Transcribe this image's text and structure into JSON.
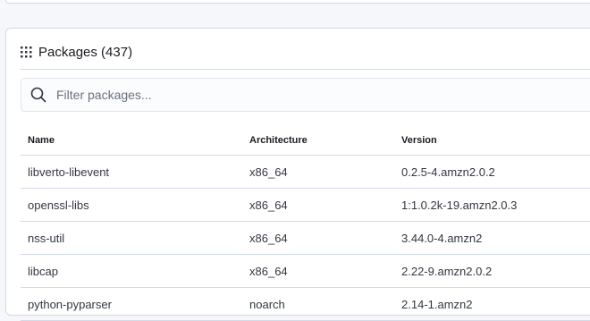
{
  "panel": {
    "title": "Packages (437)"
  },
  "search": {
    "placeholder": "Filter packages..."
  },
  "table": {
    "columns": [
      "Name",
      "Architecture",
      "Version"
    ],
    "rows": [
      {
        "name": "libverto-libevent",
        "arch": "x86_64",
        "version": "0.2.5-4.amzn2.0.2"
      },
      {
        "name": "openssl-libs",
        "arch": "x86_64",
        "version": "1:1.0.2k-19.amzn2.0.3"
      },
      {
        "name": "nss-util",
        "arch": "x86_64",
        "version": "3.44.0-4.amzn2"
      },
      {
        "name": "libcap",
        "arch": "x86_64",
        "version": "2.22-9.amzn2.0.2"
      },
      {
        "name": "python-pyparser",
        "arch": "noarch",
        "version": "2.14-1.amzn2"
      }
    ]
  },
  "icons": {
    "panel": "grid-icon",
    "search": "search-icon"
  },
  "colors": {
    "border": "#d3dae6",
    "text": "#343741",
    "placeholder": "#69707d",
    "background": "#f5f7fa"
  }
}
